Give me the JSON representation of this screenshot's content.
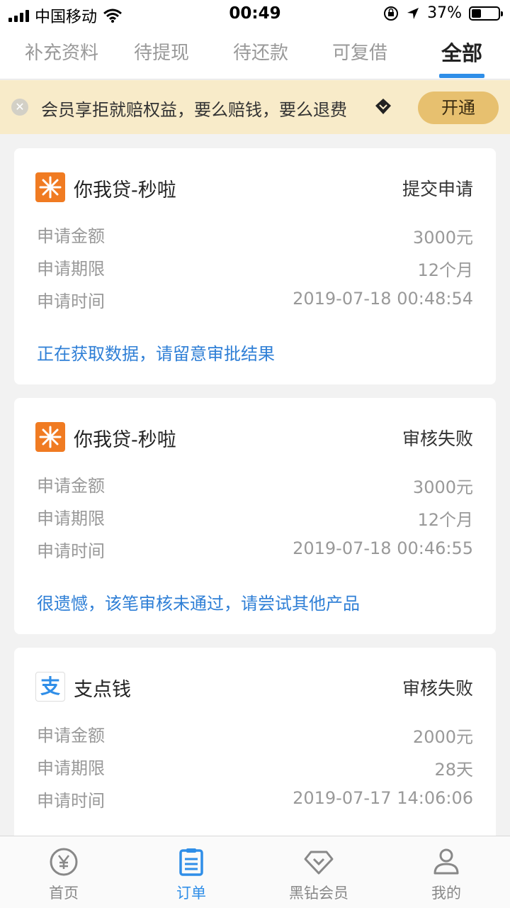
{
  "status_bar": {
    "carrier": "中国移动",
    "time": "00:49",
    "battery": "37%",
    "battery_level": 0.37
  },
  "tabs": [
    {
      "label": "补充资料"
    },
    {
      "label": "待提现"
    },
    {
      "label": "待还款"
    },
    {
      "label": "可复借"
    },
    {
      "label": "全部"
    }
  ],
  "active_tab": "全部",
  "banner": {
    "text": "会员享拒就赔权益，要么赔钱，要么退费",
    "button": "开通"
  },
  "orders": [
    {
      "product": "你我贷-秒啦",
      "status": "提交申请",
      "rows": [
        {
          "label": "申请金额",
          "value": "3000元"
        },
        {
          "label": "申请期限",
          "value": "12个月"
        },
        {
          "label": "申请时间",
          "value": "2019-07-18 00:48:54"
        }
      ],
      "message": "正在获取数据，请留意审批结果"
    },
    {
      "product": "你我贷-秒啦",
      "status": "审核失败",
      "rows": [
        {
          "label": "申请金额",
          "value": "3000元"
        },
        {
          "label": "申请期限",
          "value": "12个月"
        },
        {
          "label": "申请时间",
          "value": "2019-07-18 00:46:55"
        }
      ],
      "message": "很遗憾，该笔审核未通过，请尝试其他产品"
    },
    {
      "product": "支点钱",
      "logo_text": "支",
      "status": "审核失败",
      "rows": [
        {
          "label": "申请金额",
          "value": "2000元"
        },
        {
          "label": "申请期限",
          "value": "28天"
        },
        {
          "label": "申请时间",
          "value": "2019-07-17 14:06:06"
        }
      ]
    }
  ],
  "bottom_nav": [
    {
      "label": "首页",
      "icon": "yen-icon"
    },
    {
      "label": "订单",
      "icon": "order-list-icon"
    },
    {
      "label": "黑钻会员",
      "icon": "diamond-icon"
    },
    {
      "label": "我的",
      "icon": "person-icon"
    }
  ],
  "colors": {
    "accent": "#2f8ee8",
    "banner_bg": "#f8ebc9",
    "banner_button": "#e7c06f",
    "logo_orange": "#f07b22"
  }
}
